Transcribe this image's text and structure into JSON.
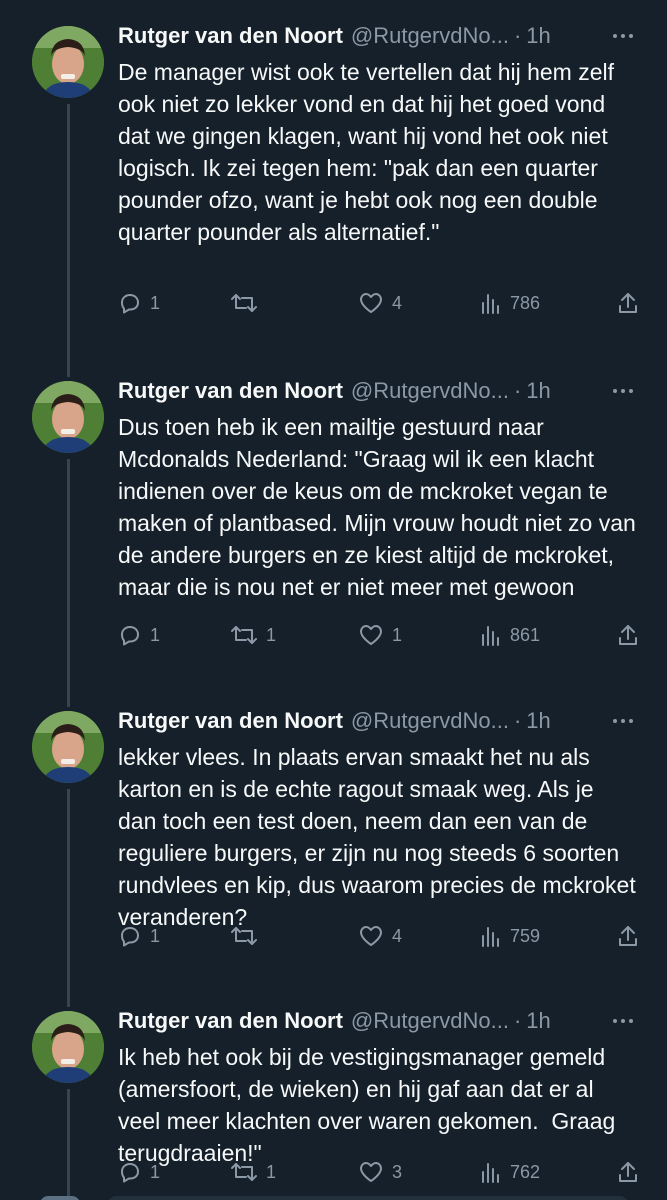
{
  "theme": {
    "background": "#15202b",
    "text": "#f7f9f9",
    "secondary": "#8b98a5",
    "thread_line": "#38444d"
  },
  "tweets": [
    {
      "name": "Rutger van den Noort",
      "handle": "@RutgervdNo...",
      "separator": "·",
      "time": "1h",
      "text": "De manager wist ook te vertellen dat hij hem zelf ook niet zo lekker vond en dat hij het goed vond dat we gingen klagen, want hij vond het ook niet logisch. Ik zei tegen hem: \"pak dan een quarter pounder ofzo, want je hebt ook nog een double quarter pounder als alternatief.\"",
      "replies": "1",
      "retweets": "",
      "likes": "4",
      "views": "786"
    },
    {
      "name": "Rutger van den Noort",
      "handle": "@RutgervdNo...",
      "separator": "·",
      "time": "1h",
      "text": "Dus toen heb ik een mailtje gestuurd naar Mcdonalds Nederland: \"Graag wil ik een klacht indienen over de keus om de mckroket vegan te maken of plantbased. Mijn vrouw houdt niet zo van de andere burgers en ze kiest altijd de mckroket, maar die is nou net er niet meer met gewoon",
      "replies": "1",
      "retweets": "1",
      "likes": "1",
      "views": "861"
    },
    {
      "name": "Rutger van den Noort",
      "handle": "@RutgervdNo...",
      "separator": "·",
      "time": "1h",
      "text": "lekker vlees. In plaats ervan smaakt het nu als karton en is de echte ragout smaak weg. Als je dan toch een test doen, neem dan een van de reguliere burgers, er zijn nu nog steeds 6 soorten rundvlees en kip, dus waarom precies de mckroket veranderen?",
      "replies": "1",
      "retweets": "",
      "likes": "4",
      "views": "759"
    },
    {
      "name": "Rutger van den Noort",
      "handle": "@RutgervdNo...",
      "separator": "·",
      "time": "1h",
      "text": "Ik heb het ook bij de vestigingsmanager gemeld (amersfoort, de wieken) en hij gaf aan dat er al veel meer klachten over waren gekomen.  Graag terugdraaien!\"",
      "replies": "1",
      "retweets": "1",
      "likes": "3",
      "views": "762"
    }
  ],
  "icons": {
    "reply": "reply-icon",
    "retweet": "retweet-icon",
    "like": "heart-icon",
    "views": "views-icon",
    "share": "share-icon",
    "more": "more-icon"
  }
}
